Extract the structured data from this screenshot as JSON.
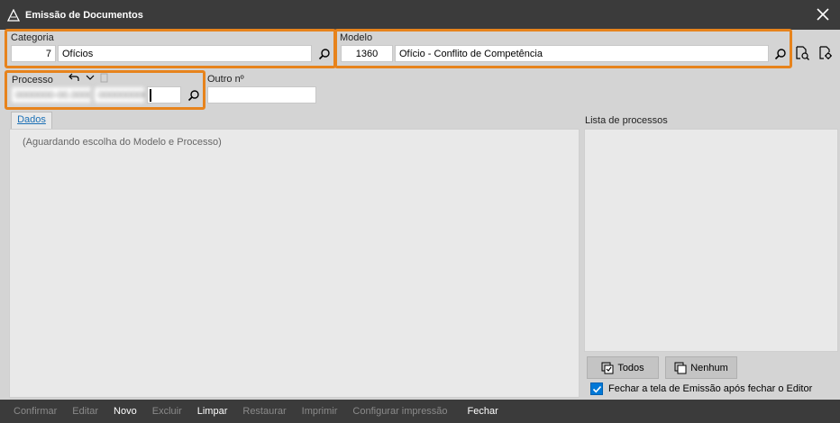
{
  "window": {
    "title": "Emissão de Documentos"
  },
  "categoria": {
    "label": "Categoria",
    "code": "7",
    "name": "Ofícios"
  },
  "modelo": {
    "label": "Modelo",
    "code": "1360",
    "name": "Ofício - Conflito de Competência"
  },
  "processo": {
    "label": "Processo",
    "part1": "0000000-00.0000",
    "part2": "0000000000",
    "part3": ""
  },
  "outro": {
    "label": "Outro nº",
    "value": ""
  },
  "tabs": {
    "dados": "Dados"
  },
  "dados": {
    "message": "(Aguardando escolha do Modelo e Processo)"
  },
  "lista": {
    "label": "Lista de processos"
  },
  "buttons": {
    "todos": "Todos",
    "nenhum": "Nenhum"
  },
  "checkbox": {
    "label": "Fechar a tela de Emissão após fechar o Editor",
    "checked": true
  },
  "actions": [
    {
      "label": "Confirmar",
      "enabled": false
    },
    {
      "label": "Editar",
      "enabled": false
    },
    {
      "label": "Novo",
      "enabled": true
    },
    {
      "label": "Excluir",
      "enabled": false
    },
    {
      "label": "Limpar",
      "enabled": true
    },
    {
      "label": "Restaurar",
      "enabled": false
    },
    {
      "label": "Imprimir",
      "enabled": false
    },
    {
      "label": "Configurar impressão",
      "enabled": false
    },
    {
      "label": "Fechar",
      "enabled": true
    }
  ],
  "colors": {
    "highlight": "#e7831c",
    "titlebar": "#3b3b3b",
    "checkbox": "#0078d7"
  }
}
